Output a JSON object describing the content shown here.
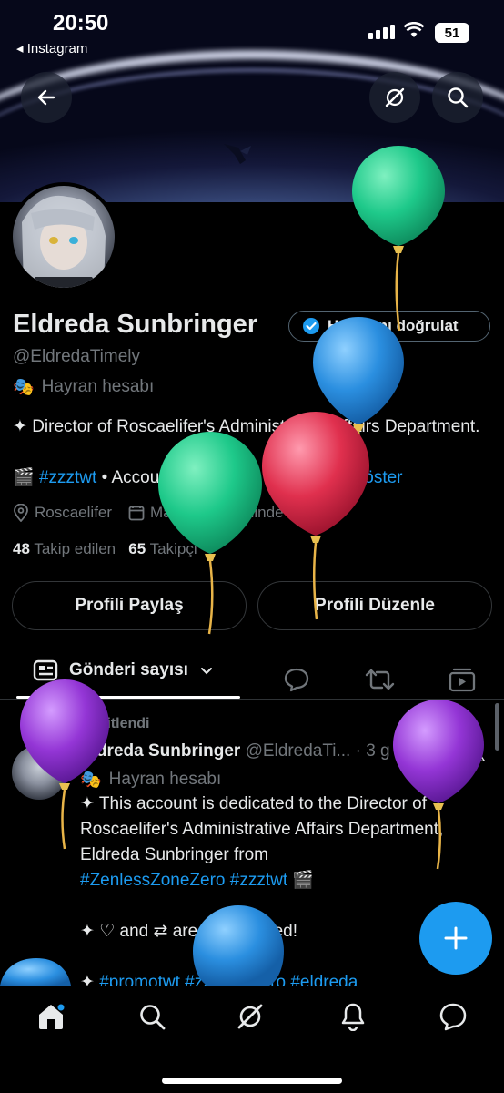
{
  "status_bar": {
    "time": "20:50",
    "back_app": "Instagram",
    "battery": "51"
  },
  "header": {
    "back_icon": "arrow-left-icon",
    "grok_icon": "grok-icon",
    "search_icon": "search-icon"
  },
  "profile": {
    "name": "Eldreda Sunbringer",
    "verify_label": "Hesabını doğrulat",
    "handle": "@EldredaTimely",
    "fan_label": "Hayran hesabı",
    "bio_line1": "✦ Director of Roscaelifer's Administrative Affairs Department.",
    "bio_emoji": "🎬",
    "bio_hashtag": "#zzztwt",
    "bio_rest": " • Account contains ... ",
    "show_more": "Daha fazla göster",
    "location": "Roscaelifer",
    "joined": "Mart 2024 tarihinde katıldı",
    "following_count": "48",
    "following_label": "Takip edilen",
    "followers_count": "65",
    "followers_label": "Takipçi"
  },
  "actions": {
    "share_label": "Profili Paylaş",
    "edit_label": "Profili Düzenle"
  },
  "tabs": {
    "posts_label": "Gönderi sayısı"
  },
  "post": {
    "pinned_label": "Sabitlendi",
    "author": "Eldreda Sunbringer",
    "handle_time": "@EldredaTi... · 3 g",
    "fan_label": "Hayran hesabı",
    "line1": "✦ This account is dedicated to the Director of Roscaelifer's Administrative Affairs Department, Eldreda Sunbringer from",
    "tags1": "#ZenlessZoneZero #zzztwt",
    "tags1_emoji": " 🎬",
    "line2": "✦ ♡ and ⇄ are appreciated!",
    "line3_prefix": "✦ ",
    "tags2": "#promotwt #zzz #zzzero #eldreda"
  },
  "colors": {
    "accent": "#1d9bf0",
    "background": "#000000",
    "muted": "#71767b"
  }
}
